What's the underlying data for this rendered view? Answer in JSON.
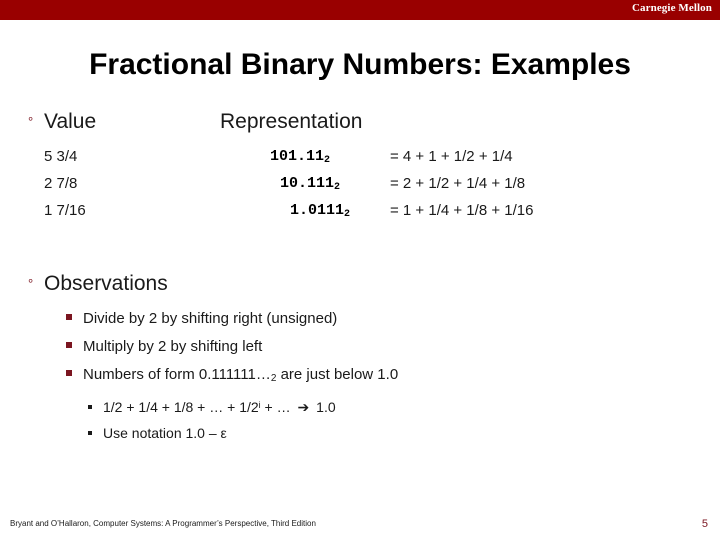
{
  "banner": {
    "institution": "Carnegie Mellon",
    "color": "#990000"
  },
  "slide": {
    "title": "Fractional Binary Numbers: Examples",
    "number": "5",
    "footer": "Bryant and O’Hallaron, Computer Systems: A Programmer’s Perspective, Third Edition"
  },
  "theme": {
    "accent": "#7b1520",
    "banner_red": "#990000",
    "text": "#1a1a1a"
  },
  "bullets": {
    "marker_level1": "°",
    "value_heading": "Value",
    "representation_heading": "Representation",
    "observations_heading": "Observations"
  },
  "table": {
    "headers": [
      "Value",
      "Representation"
    ],
    "rows": [
      {
        "value": "5 3/4",
        "representation": "101.11",
        "subscript": "2",
        "expression": "= 4 + 1 + 1/2  + 1/4",
        "indent": 0
      },
      {
        "value": "2 7/8",
        "representation": "10.111",
        "subscript": "2",
        "expression": "= 2 + 1/2  + 1/4 + 1/8",
        "indent": 1
      },
      {
        "value": "1 7/16",
        "representation": "1.0111",
        "subscript": "2",
        "expression": "= 1 + 1/4 + 1/8 + 1/16",
        "indent": 2
      }
    ]
  },
  "observations": [
    {
      "level": 2,
      "text_before": "Divide by 2 by shifting right (unsigned)",
      "subscript": "",
      "text_after": ""
    },
    {
      "level": 2,
      "text_before": "Multiply by 2 by shifting left",
      "subscript": "",
      "text_after": ""
    },
    {
      "level": 2,
      "text_before": "Numbers of form 0.111111…",
      "subscript": "2",
      "text_after": " are just below 1.0"
    }
  ],
  "sub_observations": [
    {
      "prefix": "1/2 + 1/4 + 1/8 + … + 1/2",
      "superscript": "i",
      "middle": " + … ",
      "arrow": "➔",
      "suffix": " 1.0"
    },
    {
      "prefix": "Use notation 1.0 – ε",
      "superscript": "",
      "middle": "",
      "arrow": "",
      "suffix": ""
    }
  ]
}
